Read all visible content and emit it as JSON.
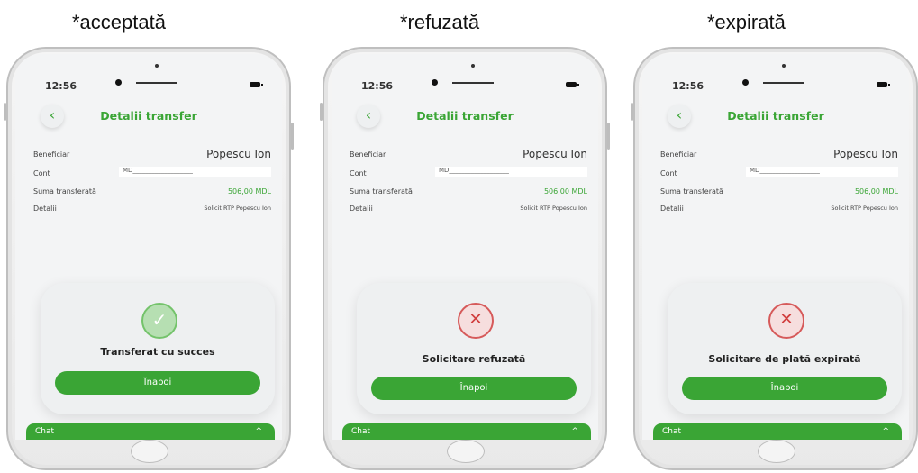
{
  "captions": [
    "*acceptată",
    "*refuzată",
    "*expirată"
  ],
  "phones": [
    {
      "time": "12:56",
      "title": "Detalii transfer",
      "labels": {
        "beneficiar": "Beneficiar",
        "cont": "Cont",
        "suma": "Suma transferată",
        "detalii": "Detalii"
      },
      "values": {
        "beneficiar": "Popescu Ion",
        "cont": "MD___________________",
        "suma": "506,00 MDL",
        "detalii": "Solicit RTP Popescu Ion"
      },
      "status": "Transferat cu succes",
      "button": "Înapoi",
      "chat": "Chat"
    },
    {
      "time": "12:56",
      "title": "Detalii transfer",
      "labels": {
        "beneficiar": "Beneficiar",
        "cont": "Cont",
        "suma": "Suma transferată",
        "detalii": "Detalii"
      },
      "values": {
        "beneficiar": "Popescu Ion",
        "cont": "MD___________________",
        "suma": "506,00 MDL",
        "detalii": "Solicit RTP Popescu Ion"
      },
      "status": "Solicitare refuzată",
      "button": "Înapoi",
      "chat": "Chat"
    },
    {
      "time": "12:56",
      "title": "Detalii transfer",
      "labels": {
        "beneficiar": "Beneficiar",
        "cont": "Cont",
        "suma": "Suma transferată",
        "detalii": "Detalii"
      },
      "values": {
        "beneficiar": "Popescu Ion",
        "cont": "MD___________________",
        "suma": "506,00 MDL",
        "detalii": "Solicit RTP Popescu Ion"
      },
      "status": "Solicitare de plată expirată",
      "button": "Înapoi",
      "chat": "Chat"
    }
  ],
  "icons": {
    "back": "chevron-left-icon",
    "chat_toggle": "chevron-up-icon",
    "success": "check-icon",
    "failure": "x-icon"
  },
  "colors": {
    "accent": "#3aa535",
    "success": "#74c36b",
    "error": "#d65a5a"
  }
}
